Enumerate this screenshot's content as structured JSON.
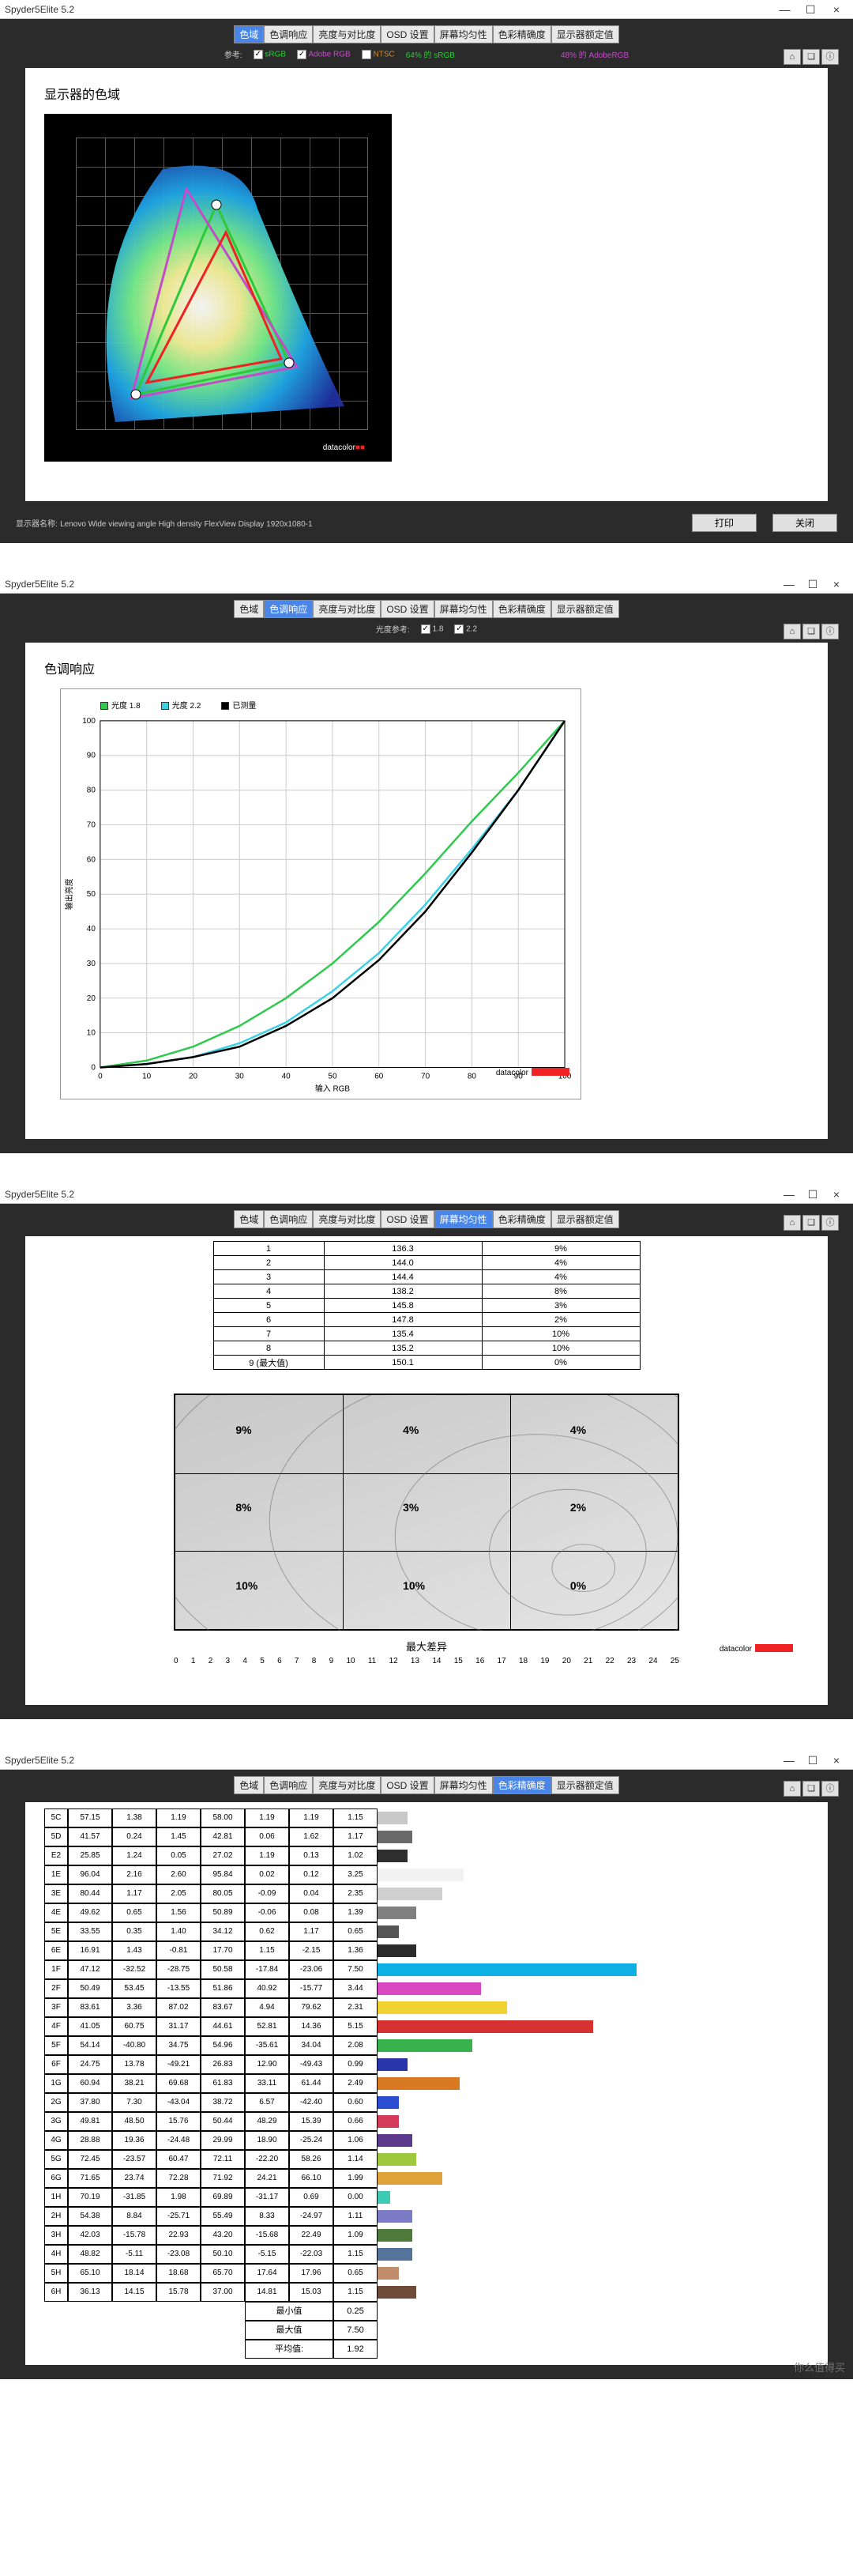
{
  "app_title": "Spyder5Elite 5.2",
  "window_controls": {
    "min": "—",
    "max": "☐",
    "close": "×"
  },
  "tabs": [
    "色域",
    "色调响应",
    "亮度与对比度",
    "OSD 设置",
    "屏幕均匀性",
    "色彩精确度",
    "显示器额定值"
  ],
  "toolbar_icons": [
    "home-icon",
    "book-icon",
    "info-icon"
  ],
  "panel1": {
    "active_tab": "色域",
    "checks": {
      "label": "参考:",
      "srgb": {
        "label": "sRGB",
        "on": true
      },
      "adobe": {
        "label": "Adobe RGB",
        "on": true
      },
      "ntsc": {
        "label": "NTSC",
        "on": false
      },
      "srgb_pct": "64% 的 sRGB",
      "adobe_pct": "48% 的 AdobeRGB"
    },
    "card_title": "显示器的色域",
    "gamut_logo": "datacolor",
    "footer": {
      "name_label": "显示器名称:",
      "name_value": "Lenovo Wide viewing angle  High density FlexView Display 1920x1080-1",
      "btn_print": "打印",
      "btn_close": "关闭"
    }
  },
  "panel2": {
    "active_tab": "色调响应",
    "checks": {
      "label": "光度参考:",
      "g18": {
        "label": "1.8",
        "on": true
      },
      "g22": {
        "label": "2.2",
        "on": true
      }
    },
    "card_title": "色调响应",
    "legend": {
      "g18": "光度 1.8",
      "g22": "光度 2.2",
      "measured": "已测量"
    },
    "xlabel": "输入 RGB",
    "ylabel": "输出亮度",
    "logo": "datacolor",
    "chart_data": {
      "type": "line",
      "x": [
        0,
        10,
        20,
        30,
        40,
        50,
        60,
        70,
        80,
        90,
        100
      ],
      "series": [
        {
          "name": "光度 1.8",
          "color": "#2fc94d",
          "values": [
            0,
            2,
            6,
            12,
            20,
            30,
            42,
            56,
            71,
            85,
            100
          ]
        },
        {
          "name": "光度 2.2",
          "color": "#3ad1e6",
          "values": [
            0,
            1,
            3,
            7,
            13,
            22,
            33,
            47,
            63,
            80,
            100
          ]
        },
        {
          "name": "已测量",
          "color": "#000000",
          "values": [
            0,
            1,
            3,
            6,
            12,
            20,
            31,
            45,
            62,
            80,
            100
          ]
        }
      ],
      "xlim": [
        0,
        100
      ],
      "ylim": [
        0,
        100
      ],
      "xlabel": "输入 RGB",
      "ylabel": "输出亮度"
    }
  },
  "panel3": {
    "active_tab": "屏幕均匀性",
    "table": [
      [
        "1",
        "136.3",
        "9%"
      ],
      [
        "2",
        "144.0",
        "4%"
      ],
      [
        "3",
        "144.4",
        "4%"
      ],
      [
        "4",
        "138.2",
        "8%"
      ],
      [
        "5",
        "145.8",
        "3%"
      ],
      [
        "6",
        "147.8",
        "2%"
      ],
      [
        "7",
        "135.4",
        "10%"
      ],
      [
        "8",
        "135.2",
        "10%"
      ],
      [
        "9  (最大值)",
        "150.1",
        "0%"
      ]
    ],
    "grid_values": [
      [
        "9%",
        "4%",
        "4%"
      ],
      [
        "8%",
        "3%",
        "2%"
      ],
      [
        "10%",
        "10%",
        "0%"
      ]
    ],
    "caption": "最大差异",
    "scale": [
      "0",
      "1",
      "2",
      "3",
      "4",
      "5",
      "6",
      "7",
      "8",
      "9",
      "10",
      "11",
      "12",
      "13",
      "14",
      "15",
      "16",
      "17",
      "18",
      "19",
      "20",
      "21",
      "22",
      "23",
      "24",
      "25"
    ],
    "logo": "datacolor"
  },
  "panel4": {
    "active_tab": "色彩精确度",
    "rows": [
      {
        "code": "5C",
        "v": [
          "57.15",
          "1.38",
          "1.19",
          "58.00",
          "1.19",
          "1.19",
          "1.15"
        ],
        "barw": 7,
        "color": "#c9c9c9"
      },
      {
        "code": "5D",
        "v": [
          "41.57",
          "0.24",
          "1.45",
          "42.81",
          "0.06",
          "1.62",
          "1.17"
        ],
        "barw": 8,
        "color": "#6a6a6a"
      },
      {
        "code": "E2",
        "v": [
          "25.85",
          "1.24",
          "0.05",
          "27.02",
          "1.19",
          "0.13",
          "1.02"
        ],
        "barw": 7,
        "color": "#2e2e2e"
      },
      {
        "code": "1E",
        "v": [
          "96.04",
          "2.16",
          "2.60",
          "95.84",
          "0.02",
          "0.12",
          "3.25"
        ],
        "barw": 20,
        "color": "#f2f2f2"
      },
      {
        "code": "3E",
        "v": [
          "80.44",
          "1.17",
          "2.05",
          "80.05",
          "-0.09",
          "0.04",
          "2.35"
        ],
        "barw": 15,
        "color": "#cfcfcf"
      },
      {
        "code": "4E",
        "v": [
          "49.62",
          "0.65",
          "1.56",
          "50.89",
          "-0.06",
          "0.08",
          "1.39"
        ],
        "barw": 9,
        "color": "#808080"
      },
      {
        "code": "5E",
        "v": [
          "33.55",
          "0.35",
          "1.40",
          "34.12",
          "0.62",
          "1.17",
          "0.65"
        ],
        "barw": 5,
        "color": "#555555"
      },
      {
        "code": "6E",
        "v": [
          "16.91",
          "1.43",
          "-0.81",
          "17.70",
          "1.15",
          "-2.15",
          "1.36"
        ],
        "barw": 9,
        "color": "#2b2b2b"
      },
      {
        "code": "1F",
        "v": [
          "47.12",
          "-32.52",
          "-28.75",
          "50.58",
          "-17.84",
          "-23.06",
          "7.50"
        ],
        "barw": 60,
        "color": "#0fb0e3"
      },
      {
        "code": "2F",
        "v": [
          "50.49",
          "53.45",
          "-13.55",
          "51.86",
          "40.92",
          "-15.77",
          "3.44"
        ],
        "barw": 24,
        "color": "#d948c1"
      },
      {
        "code": "3F",
        "v": [
          "83.61",
          "3.36",
          "87.02",
          "83.67",
          "4.94",
          "79.62",
          "2.31"
        ],
        "barw": 30,
        "color": "#f0d330"
      },
      {
        "code": "4F",
        "v": [
          "41.05",
          "60.75",
          "31.17",
          "44.61",
          "52.81",
          "14.36",
          "5.15"
        ],
        "barw": 50,
        "color": "#d63030"
      },
      {
        "code": "5F",
        "v": [
          "54.14",
          "-40.80",
          "34.75",
          "54.96",
          "-35.61",
          "34.04",
          "2.08"
        ],
        "barw": 22,
        "color": "#38b24c"
      },
      {
        "code": "6F",
        "v": [
          "24.75",
          "13.78",
          "-49.21",
          "26.83",
          "12.90",
          "-49.43",
          "0.99"
        ],
        "barw": 7,
        "color": "#2936aa"
      },
      {
        "code": "1G",
        "v": [
          "60.94",
          "38.21",
          "69.68",
          "61.83",
          "33.11",
          "61.44",
          "2.49"
        ],
        "barw": 19,
        "color": "#d97a22"
      },
      {
        "code": "2G",
        "v": [
          "37.80",
          "7.30",
          "-43.04",
          "38.72",
          "6.57",
          "-42.40",
          "0.60"
        ],
        "barw": 5,
        "color": "#2b4dd2"
      },
      {
        "code": "3G",
        "v": [
          "49.81",
          "48.50",
          "15.76",
          "50.44",
          "48.29",
          "15.39",
          "0.66"
        ],
        "barw": 5,
        "color": "#d33b59"
      },
      {
        "code": "4G",
        "v": [
          "28.88",
          "19.36",
          "-24.48",
          "29.99",
          "18.90",
          "-25.24",
          "1.06"
        ],
        "barw": 8,
        "color": "#5c3a8b"
      },
      {
        "code": "5G",
        "v": [
          "72.45",
          "-23.57",
          "60.47",
          "72.11",
          "-22.20",
          "58.26",
          "1.14"
        ],
        "barw": 9,
        "color": "#9ec83e"
      },
      {
        "code": "6G",
        "v": [
          "71.65",
          "23.74",
          "72.28",
          "71.92",
          "24.21",
          "66.10",
          "1.99"
        ],
        "barw": 15,
        "color": "#e0a33c"
      },
      {
        "code": "1H",
        "v": [
          "70.19",
          "-31.85",
          "1.98",
          "69.89",
          "-31.17",
          "0.69",
          "0.00"
        ],
        "barw": 3,
        "color": "#3dcbb4"
      },
      {
        "code": "2H",
        "v": [
          "54.38",
          "8.84",
          "-25.71",
          "55.49",
          "8.33",
          "-24.97",
          "1.11"
        ],
        "barw": 8,
        "color": "#7c7cc6"
      },
      {
        "code": "3H",
        "v": [
          "42.03",
          "-15.78",
          "22.93",
          "43.20",
          "-15.68",
          "22.49",
          "1.09"
        ],
        "barw": 8,
        "color": "#4f7a3b"
      },
      {
        "code": "4H",
        "v": [
          "48.82",
          "-5.11",
          "-23.08",
          "50.10",
          "-5.15",
          "-22.03",
          "1.15"
        ],
        "barw": 8,
        "color": "#55749b"
      },
      {
        "code": "5H",
        "v": [
          "65.10",
          "18.14",
          "18.68",
          "65.70",
          "17.64",
          "17.96",
          "0.65"
        ],
        "barw": 5,
        "color": "#c28d6a"
      },
      {
        "code": "6H",
        "v": [
          "36.13",
          "14.15",
          "15.78",
          "37.00",
          "14.81",
          "15.03",
          "1.15"
        ],
        "barw": 9,
        "color": "#6e4c39"
      }
    ],
    "summary": [
      {
        "label": "最小值",
        "value": "0.25"
      },
      {
        "label": "最大值",
        "value": "7.50"
      },
      {
        "label": "平均值:",
        "value": "1.92"
      }
    ]
  },
  "watermark": "你么值得买"
}
